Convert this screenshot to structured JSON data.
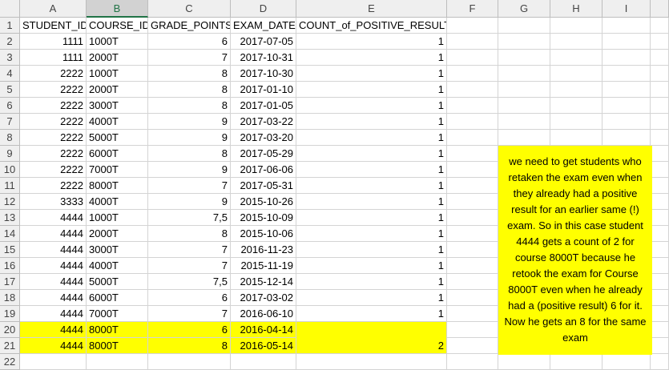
{
  "columns": [
    "A",
    "B",
    "C",
    "D",
    "E",
    "F",
    "G",
    "H",
    "I"
  ],
  "selected_column": "B",
  "headers": [
    "STUDENT_ID",
    "COURSE_ID",
    "GRADE_POINTS",
    "EXAM_DATE",
    "COUNT_of_POSITIVE_RESULT"
  ],
  "rows": [
    [
      "1111",
      "1000T",
      "6",
      "2017-07-05",
      "1"
    ],
    [
      "1111",
      "2000T",
      "7",
      "2017-10-31",
      "1"
    ],
    [
      "2222",
      "1000T",
      "8",
      "2017-10-30",
      "1"
    ],
    [
      "2222",
      "2000T",
      "8",
      "2017-01-10",
      "1"
    ],
    [
      "2222",
      "3000T",
      "8",
      "2017-01-05",
      "1"
    ],
    [
      "2222",
      "4000T",
      "9",
      "2017-03-22",
      "1"
    ],
    [
      "2222",
      "5000T",
      "9",
      "2017-03-20",
      "1"
    ],
    [
      "2222",
      "6000T",
      "8",
      "2017-05-29",
      "1"
    ],
    [
      "2222",
      "7000T",
      "9",
      "2017-06-06",
      "1"
    ],
    [
      "2222",
      "8000T",
      "7",
      "2017-05-31",
      "1"
    ],
    [
      "3333",
      "4000T",
      "9",
      "2015-10-26",
      "1"
    ],
    [
      "4444",
      "1000T",
      "7,5",
      "2015-10-09",
      "1"
    ],
    [
      "4444",
      "2000T",
      "8",
      "2015-10-06",
      "1"
    ],
    [
      "4444",
      "3000T",
      "7",
      "2016-11-23",
      "1"
    ],
    [
      "4444",
      "4000T",
      "7",
      "2015-11-19",
      "1"
    ],
    [
      "4444",
      "5000T",
      "7,5",
      "2015-12-14",
      "1"
    ],
    [
      "4444",
      "6000T",
      "6",
      "2017-03-02",
      "1"
    ],
    [
      "4444",
      "7000T",
      "7",
      "2016-06-10",
      "1"
    ],
    [
      "4444",
      "8000T",
      "6",
      "2016-04-14",
      ""
    ],
    [
      "4444",
      "8000T",
      "8",
      "2016-05-14",
      "2"
    ]
  ],
  "highlight_rows": [
    20,
    21
  ],
  "highlight_color": "#ffff00",
  "note": "we need to get students who retaken the exam even when they already had a positive result for an earlier same (!) exam. So in this case student 4444 gets a count of 2 for course 8000T because he retook the exam for Course 8000T even when he already had a (positive result) 6 for it. Now he gets an 8 for the same exam"
}
